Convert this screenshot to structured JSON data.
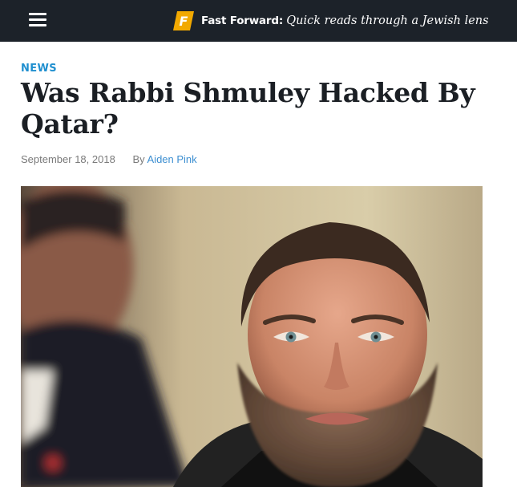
{
  "header": {
    "brand_label": "Fast Forward:",
    "tagline": "Quick reads through a Jewish lens",
    "logo_letter": "F",
    "logo_color": "#f2a900",
    "menu_icon": "hamburger-menu-icon",
    "background": "#1c2229"
  },
  "article": {
    "category": "NEWS",
    "title": "Was Rabbi Shmuley Hacked By Qatar?",
    "date": "September 18, 2018",
    "byline_prefix": "By",
    "author": "Aiden Pink",
    "accent_color": "#1f8fcf"
  }
}
